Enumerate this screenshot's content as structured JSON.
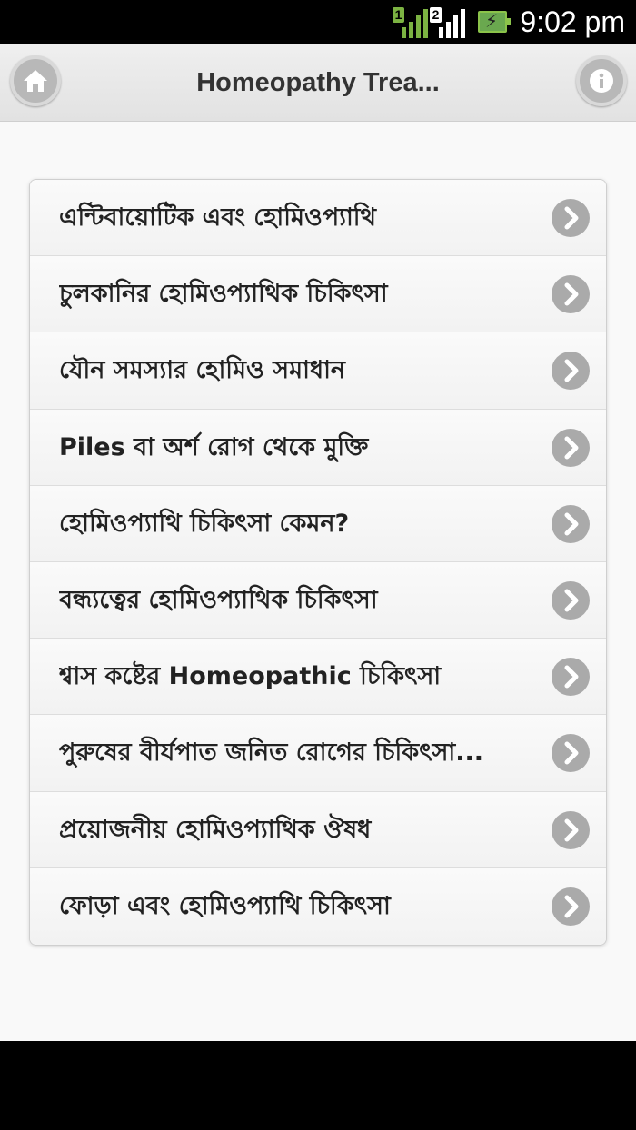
{
  "status": {
    "time": "9:02 pm",
    "sim1_label": "1",
    "sim2_label": "2"
  },
  "header": {
    "title": "Homeopathy Trea..."
  },
  "list": {
    "items": [
      {
        "label": "এন্টিবায়োটিক এবং হোমিওপ্যাথি"
      },
      {
        "label": "চুলকানির হোমিওপ্যাথিক চিকিৎসা"
      },
      {
        "label": "যৌন সমস্যার হোমিও সমাধান"
      },
      {
        "label": "Piles বা অর্শ রোগ থেকে মুক্তি"
      },
      {
        "label": "হোমিওপ্যাথি চিকিৎসা কেমন?"
      },
      {
        "label": "বন্ধ্যত্বের হোমিওপ্যাথিক চিকিৎসা"
      },
      {
        "label": "শ্বাস কষ্টের Homeopathic চিকিৎসা"
      },
      {
        "label": "পুরুষের বীর্যপাত জনিত রোগের চিকিৎসা..."
      },
      {
        "label": "প্রয়োজনীয় হোমিওপ্যাথিক ঔষধ"
      },
      {
        "label": "ফোড়া এবং হোমিওপ্যাথি চিকিৎসা"
      }
    ]
  },
  "icons": {
    "home": "home-icon",
    "info": "info-icon",
    "chevron": "chevron-right-icon"
  },
  "colors": {
    "sim1": "#7cb342",
    "sim2": "#ffffff",
    "battery": "#6aa84f"
  }
}
